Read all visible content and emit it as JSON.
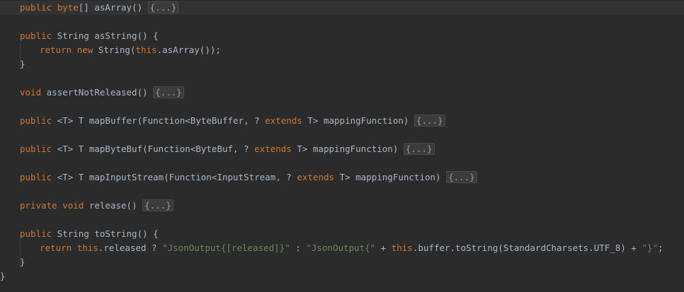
{
  "editor": {
    "lines": [
      {
        "indent": 28,
        "segs": [
          {
            "t": "public ",
            "c": "kw"
          },
          {
            "t": "byte",
            "c": "kw"
          },
          {
            "t": "[] asArray() "
          },
          {
            "t": "{...}",
            "c": "fold"
          }
        ],
        "current": true
      },
      {
        "indent": 28,
        "segs": []
      },
      {
        "indent": 28,
        "segs": [
          {
            "t": "public ",
            "c": "kw"
          },
          {
            "t": "String asString() {"
          }
        ]
      },
      {
        "indent": 56,
        "segs": [
          {
            "t": "return ",
            "c": "kw"
          },
          {
            "t": "new ",
            "c": "kw"
          },
          {
            "t": "String("
          },
          {
            "t": "this",
            "c": "kw"
          },
          {
            "t": ".asArray());"
          }
        ]
      },
      {
        "indent": 28,
        "segs": [
          {
            "t": "}"
          }
        ]
      },
      {
        "indent": 28,
        "segs": []
      },
      {
        "indent": 28,
        "segs": [
          {
            "t": "void ",
            "c": "kw"
          },
          {
            "t": "assertNotReleased() "
          },
          {
            "t": "{...}",
            "c": "fold"
          }
        ]
      },
      {
        "indent": 28,
        "segs": []
      },
      {
        "indent": 28,
        "segs": [
          {
            "t": "public ",
            "c": "kw"
          },
          {
            "t": "<T> T mapBuffer(Function<ByteBuffer, ? "
          },
          {
            "t": "extends ",
            "c": "kw"
          },
          {
            "t": "T> mappingFunction) "
          },
          {
            "t": "{...}",
            "c": "fold"
          }
        ]
      },
      {
        "indent": 28,
        "segs": []
      },
      {
        "indent": 28,
        "segs": [
          {
            "t": "public ",
            "c": "kw"
          },
          {
            "t": "<T> T mapByteBuf(Function<ByteBuf, ? "
          },
          {
            "t": "extends ",
            "c": "kw"
          },
          {
            "t": "T> mappingFunction) "
          },
          {
            "t": "{...}",
            "c": "fold"
          }
        ]
      },
      {
        "indent": 28,
        "segs": []
      },
      {
        "indent": 28,
        "segs": [
          {
            "t": "public ",
            "c": "kw"
          },
          {
            "t": "<T> T mapInputStream(Function<InputStream, ? "
          },
          {
            "t": "extends ",
            "c": "kw"
          },
          {
            "t": "T> mappingFunction) "
          },
          {
            "t": "{...}",
            "c": "fold"
          }
        ]
      },
      {
        "indent": 28,
        "segs": []
      },
      {
        "indent": 28,
        "segs": [
          {
            "t": "private ",
            "c": "kw"
          },
          {
            "t": "void ",
            "c": "kw"
          },
          {
            "t": "release() "
          },
          {
            "t": "{...}",
            "c": "fold"
          }
        ]
      },
      {
        "indent": 28,
        "segs": []
      },
      {
        "indent": 28,
        "segs": [
          {
            "t": "public ",
            "c": "kw"
          },
          {
            "t": "String toString() {"
          }
        ]
      },
      {
        "indent": 56,
        "segs": [
          {
            "t": "return ",
            "c": "kw"
          },
          {
            "t": "this",
            "c": "kw"
          },
          {
            "t": ".released ? "
          },
          {
            "t": "\"JsonOutput{[released]}\"",
            "c": "str"
          },
          {
            "t": " : "
          },
          {
            "t": "\"JsonOutput{\"",
            "c": "str"
          },
          {
            "t": " + "
          },
          {
            "t": "this",
            "c": "kw"
          },
          {
            "t": ".buffer.toString(StandardCharsets.UTF_8) + "
          },
          {
            "t": "\"}\"",
            "c": "str"
          },
          {
            "t": ";"
          }
        ]
      },
      {
        "indent": 28,
        "segs": [
          {
            "t": "}"
          }
        ]
      },
      {
        "indent": 0,
        "segs": [
          {
            "t": "}"
          }
        ]
      }
    ]
  }
}
